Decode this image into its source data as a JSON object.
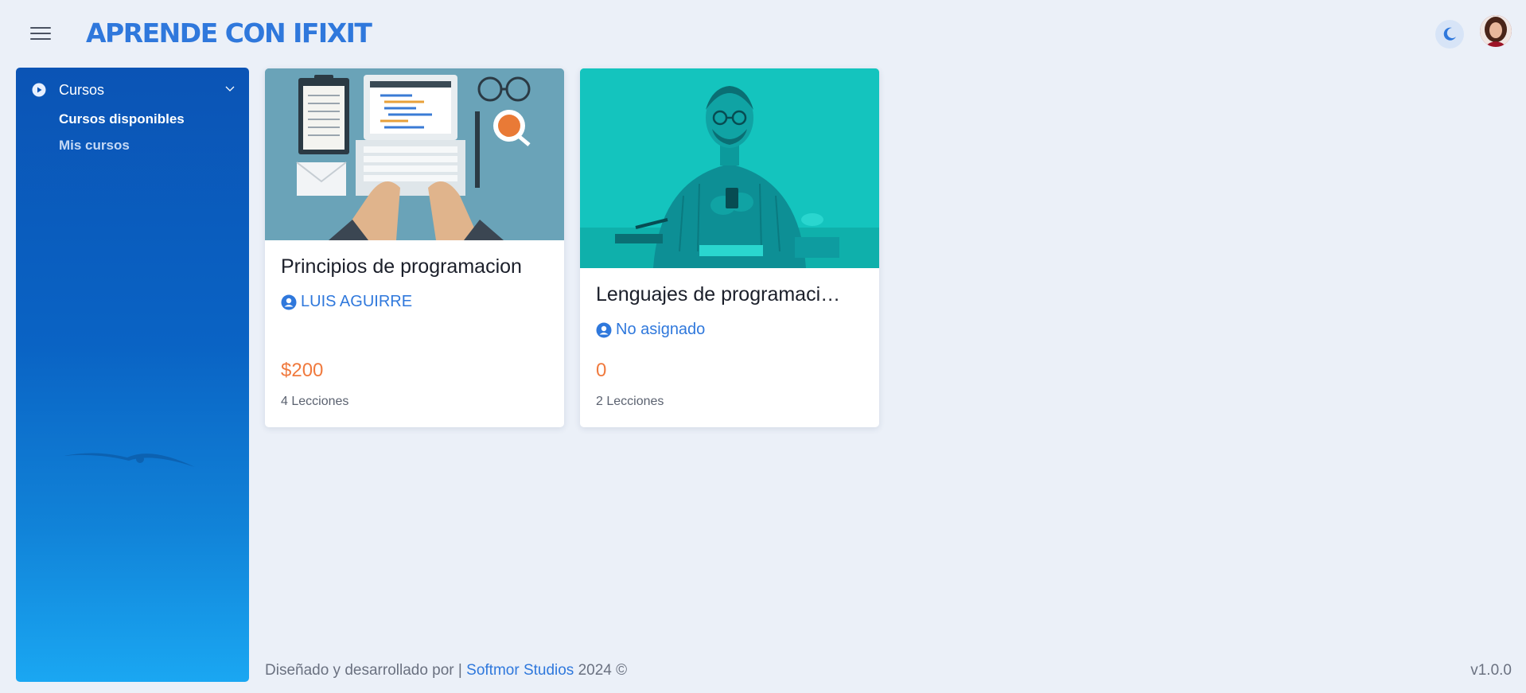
{
  "header": {
    "title": "APRENDE CON IFIXIT",
    "menu_icon": "hamburger-icon",
    "theme_icon": "moon-icon",
    "accent": "#2f78dc"
  },
  "sidebar": {
    "group": {
      "label": "Cursos",
      "icon": "play-circle-icon",
      "expanded": true
    },
    "items": [
      {
        "label": "Cursos disponibles",
        "active": true
      },
      {
        "label": "Mis cursos",
        "active": false
      }
    ]
  },
  "courses": [
    {
      "title": "Principios de programacion",
      "author": "LUIS AGUIRRE",
      "price": "$200",
      "lessons": "4 Lecciones"
    },
    {
      "title": "Lenguajes de programaci…",
      "author": "No asignado",
      "price": "0",
      "lessons": "2 Lecciones"
    }
  ],
  "footer": {
    "prefix": "Diseñado y desarrollado por |",
    "link": "Softmor Studios",
    "suffix": "2024 ©",
    "version": "v1.0.0"
  },
  "colors": {
    "price": "#f07a3e",
    "sidebar_top": "#0b54b5",
    "sidebar_bottom": "#1aa7f2"
  }
}
